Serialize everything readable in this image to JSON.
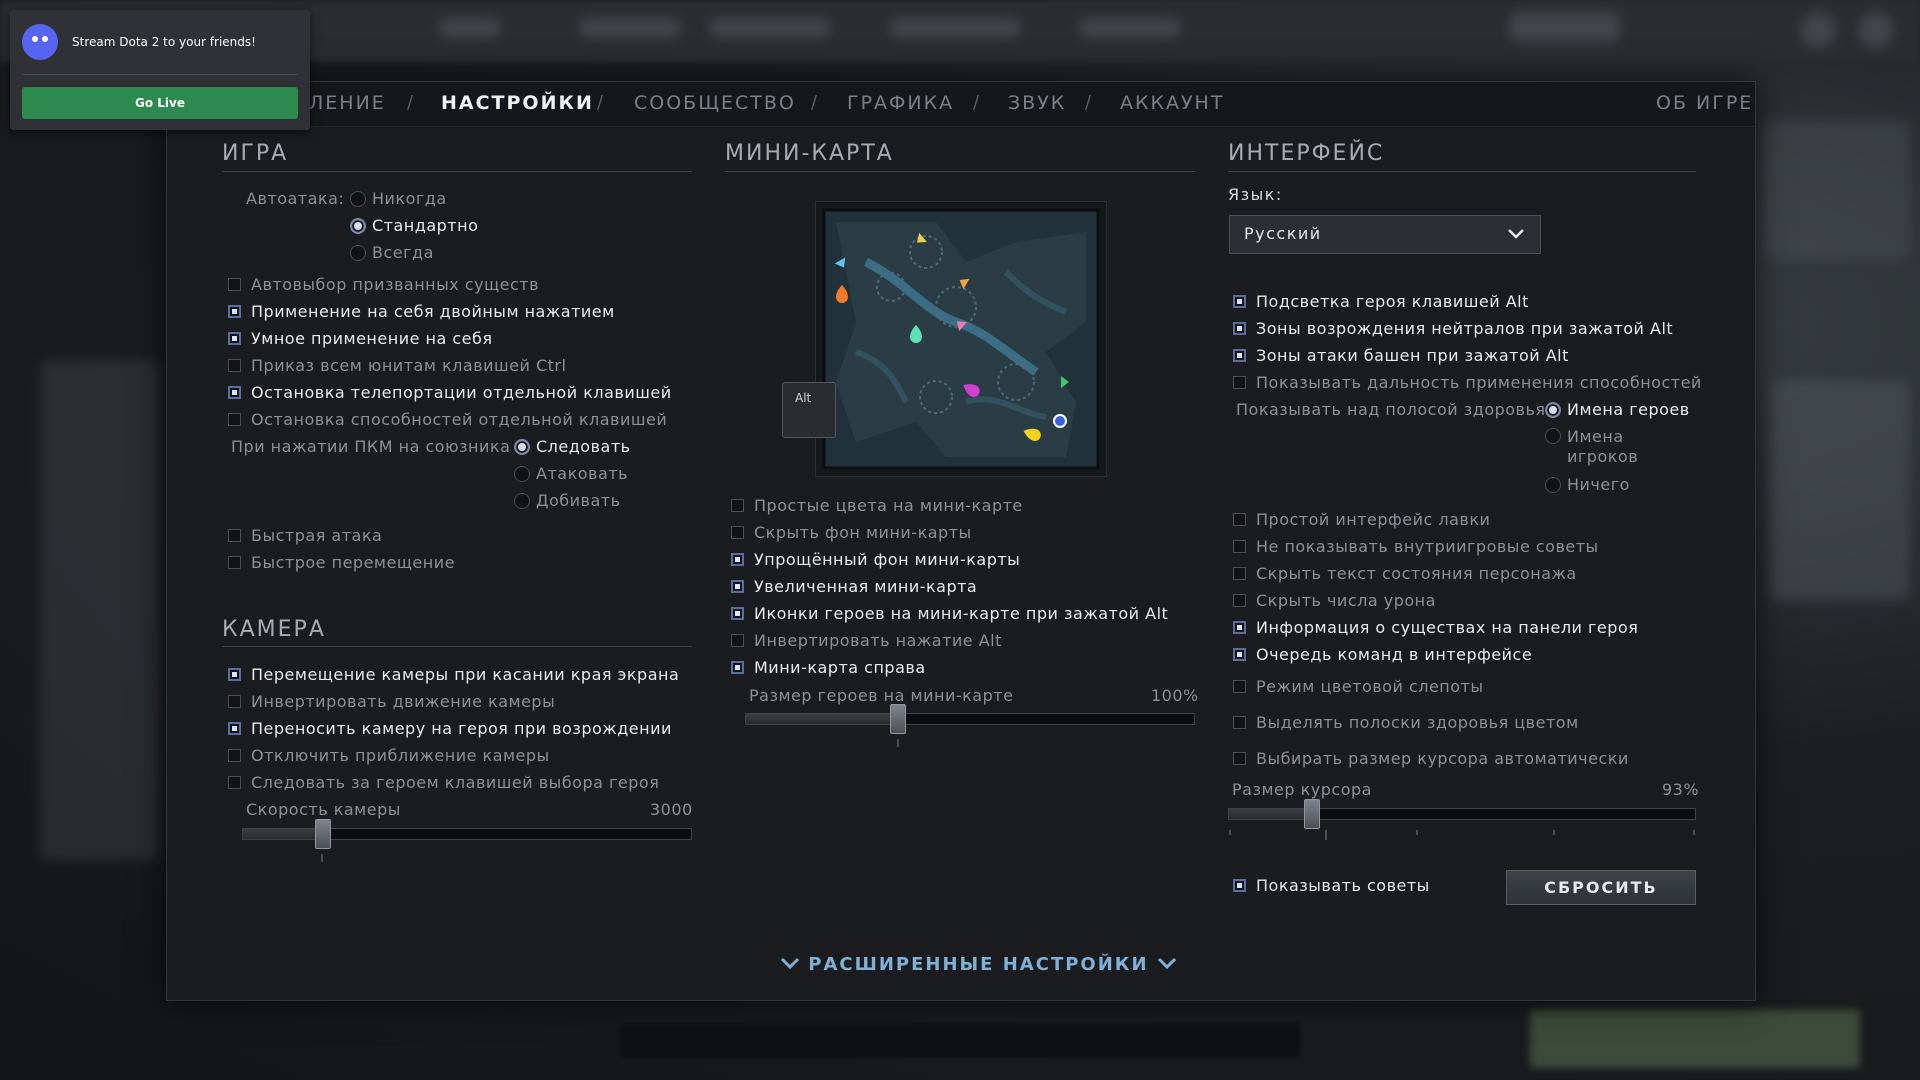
{
  "stream_popup": {
    "message": "Stream Dota 2 to your friends!",
    "button": "Go Live"
  },
  "nav": {
    "items": [
      {
        "label": "ЛЕНИЕ"
      },
      {
        "label": "НАСТРОЙКИ"
      },
      {
        "label": "СООБЩЕСТВО"
      },
      {
        "label": "ГРАФИКА"
      },
      {
        "label": "ЗВУК"
      },
      {
        "label": "АККАУНТ"
      }
    ],
    "separator": "/",
    "about": "ОБ ИГРЕ"
  },
  "game": {
    "title": "ИГРА",
    "autoattack_label": "Автоатака:",
    "autoattack_options": [
      "Никогда",
      "Стандартно",
      "Всегда"
    ],
    "autoattack_selected": "Стандартно",
    "options": [
      {
        "label": "Автовыбор призванных существ",
        "checked": false
      },
      {
        "label": "Применение на себя двойным нажатием",
        "checked": true
      },
      {
        "label": "Умное применение на себя",
        "checked": true
      },
      {
        "label": "Приказ всем юнитам клавишей Ctrl",
        "checked": false
      },
      {
        "label": "Остановка телепортации отдельной клавишей",
        "checked": true
      },
      {
        "label": "Остановка способностей отдельной клавишей",
        "checked": false
      }
    ],
    "rmb_label": "При нажатии ПКМ на союзника",
    "rmb_options": [
      "Следовать",
      "Атаковать",
      "Добивать"
    ],
    "rmb_selected": "Следовать",
    "options2": [
      {
        "label": "Быстрая атака",
        "checked": false
      },
      {
        "label": "Быстрое перемещение",
        "checked": false
      }
    ]
  },
  "camera": {
    "title": "КАМЕРА",
    "options": [
      {
        "label": "Перемещение камеры при касании края экрана",
        "checked": true
      },
      {
        "label": "Инвертировать движение камеры",
        "checked": false
      },
      {
        "label": "Переносить камеру на героя при возрождении",
        "checked": true
      },
      {
        "label": "Отключить приближение камеры",
        "checked": false
      },
      {
        "label": "Следовать за героем клавишей выбора героя",
        "checked": false
      }
    ],
    "speed_label": "Скорость камеры",
    "speed_value": "3000",
    "speed_fraction": 0.18
  },
  "minimap": {
    "title": "МИНИ-КАРТА",
    "alt_label": "Alt",
    "options": [
      {
        "label": "Простые цвета на мини-карте",
        "checked": false
      },
      {
        "label": "Скрыть фон мини-карты",
        "checked": false
      },
      {
        "label": "Упрощённый фон мини-карты",
        "checked": true
      },
      {
        "label": "Увеличенная мини-карта",
        "checked": true
      },
      {
        "label": "Иконки героев на мини-карте при зажатой Alt",
        "checked": true
      },
      {
        "label": "Инвертировать нажатие Alt",
        "checked": false
      },
      {
        "label": "Мини-карта справа",
        "checked": true
      }
    ],
    "hero_size_label": "Размер героев на мини-карте",
    "hero_size_value": "100%",
    "hero_size_fraction": 0.34
  },
  "interface": {
    "title": "ИНТЕРФЕЙС",
    "language_label": "Язык:",
    "language_value": "Русский",
    "options": [
      {
        "label": "Подсветка героя клавишей Alt",
        "checked": true
      },
      {
        "label": "Зоны возрождения нейтралов при зажатой Alt",
        "checked": true
      },
      {
        "label": "Зоны атаки башен при зажатой Alt",
        "checked": true
      },
      {
        "label": "Показывать дальность применения способностей",
        "checked": false
      }
    ],
    "health_label": "Показывать над полосой здоровья:",
    "health_options": [
      "Имена героев",
      "Имена игроков",
      "Ничего"
    ],
    "health_selected": "Имена героев",
    "options2": [
      {
        "label": "Простой интерфейс лавки",
        "checked": false
      },
      {
        "label": "Не показывать внутриигровые советы",
        "checked": false
      },
      {
        "label": "Скрыть текст состояния персонажа",
        "checked": false
      },
      {
        "label": "Скрыть числа урона",
        "checked": false
      },
      {
        "label": "Информация о существах на панели героя",
        "checked": true
      },
      {
        "label": "Очередь команд в интерфейсе",
        "checked": true
      },
      {
        "label": "Режим цветовой слепоты",
        "checked": false
      },
      {
        "label": "Выделять полоски здоровья цветом",
        "checked": false
      },
      {
        "label": "Выбирать размер курсора автоматически",
        "checked": false
      }
    ],
    "cursor_label": "Размер курсора",
    "cursor_value": "93%",
    "cursor_fraction": 0.18,
    "show_tips": {
      "label": "Показывать советы",
      "checked": true
    },
    "reset_button": "СБРОСИТЬ"
  },
  "advanced": "РАСШИРЕННЫЕ НАСТРОЙКИ",
  "colors": {
    "accent_link": "#7fb1d8",
    "golive": "#2d8a4e",
    "checkbox_checked": "#dfe6f3"
  }
}
